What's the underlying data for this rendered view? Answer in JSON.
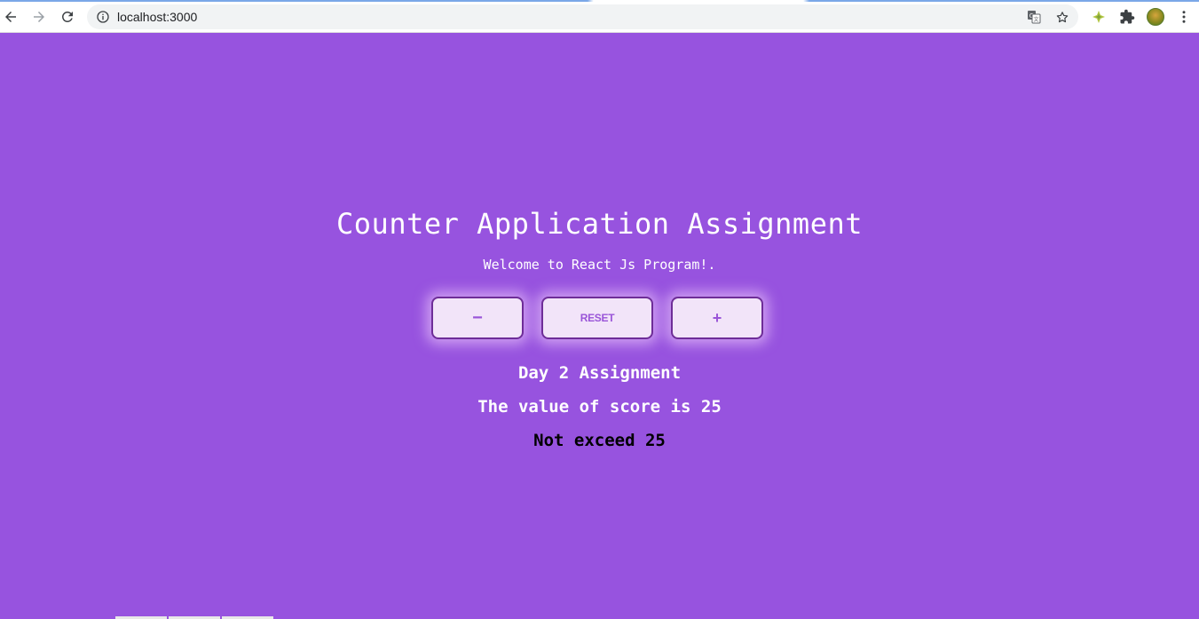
{
  "browser": {
    "url": "localhost:3000",
    "icons": {
      "back": "arrow-left-icon",
      "forward": "arrow-right-icon",
      "reload": "reload-icon",
      "info": "info-icon",
      "translate": "translate-icon",
      "bookmark": "star-icon",
      "extension": "extension-icon",
      "puzzle": "puzzle-icon",
      "profile": "avatar",
      "menu": "more-vert-icon"
    }
  },
  "app": {
    "title": "Counter Application Assignment",
    "subtitle": "Welcome to React Js Program!.",
    "buttons": {
      "decrement_label": "−",
      "reset_label": "RESET",
      "increment_label": "+"
    },
    "day_label": "Day 2 Assignment",
    "score_text": "The value of score is 25",
    "limit_text": "Not exceed 25"
  },
  "colors": {
    "background": "#9753df",
    "button_bg": "#f2e4f9",
    "button_border": "#6e2d98",
    "button_text": "#9a55d8"
  }
}
